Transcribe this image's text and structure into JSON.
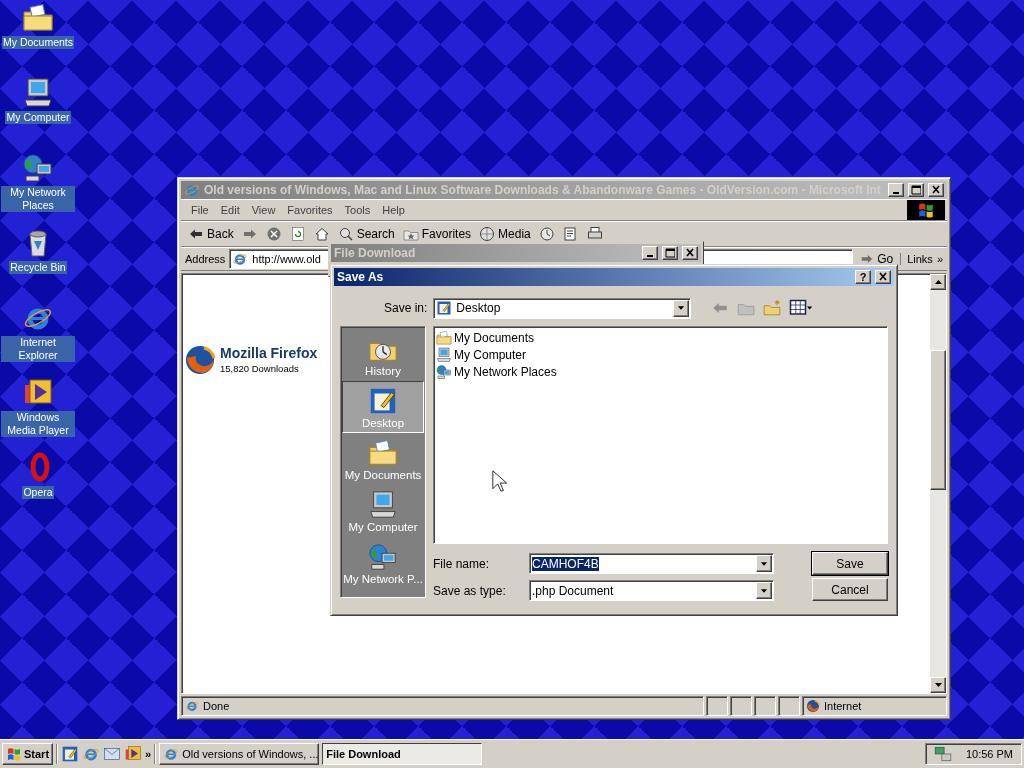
{
  "desktop_icons": [
    {
      "label": "My Documents",
      "kind": "documents"
    },
    {
      "label": "My Computer",
      "kind": "computer"
    },
    {
      "label": "My Network Places",
      "kind": "network"
    },
    {
      "label": "Recycle Bin",
      "kind": "recycle"
    },
    {
      "label": "Internet Explorer",
      "kind": "ie"
    },
    {
      "label": "Windows Media Player",
      "kind": "media"
    },
    {
      "label": "Opera",
      "kind": "opera"
    }
  ],
  "browser": {
    "title": "Old versions of Windows, Mac and Linux Software Downloads & Abandonware Games - OldVersion.com - Microsoft Int",
    "menu": [
      "File",
      "Edit",
      "View",
      "Favorites",
      "Tools",
      "Help"
    ],
    "toolbar": [
      {
        "kind": "back",
        "label": "Back"
      },
      {
        "kind": "forward"
      },
      {
        "kind": "stop"
      },
      {
        "kind": "refresh"
      },
      {
        "kind": "home"
      },
      {
        "kind": "search",
        "label": "Search"
      },
      {
        "kind": "favorites",
        "label": "Favorites"
      },
      {
        "kind": "media",
        "label": "Media"
      },
      {
        "kind": "history"
      },
      {
        "kind": "mail"
      },
      {
        "kind": "print"
      }
    ],
    "address_label": "Address",
    "address": "http://www.old",
    "go": "Go",
    "links": "Links",
    "links_chevron": "»",
    "page": {
      "title": "Mozilla Firefox",
      "downloads": "15,820 Downloads"
    },
    "status": "Done",
    "zone": "Internet"
  },
  "file_download": {
    "title": "File Download"
  },
  "save_as": {
    "title": "Save As",
    "help": "?",
    "save_in_label": "Save in:",
    "save_in": "Desktop",
    "places": [
      {
        "label": "History",
        "kind": "history",
        "selected": false
      },
      {
        "label": "Desktop",
        "kind": "desktop",
        "selected": true
      },
      {
        "label": "My Documents",
        "kind": "documents",
        "selected": false
      },
      {
        "label": "My Computer",
        "kind": "computer",
        "selected": false
      },
      {
        "label": "My Network P...",
        "kind": "network",
        "selected": false
      }
    ],
    "files": [
      {
        "name": "My Documents",
        "kind": "documents"
      },
      {
        "name": "My Computer",
        "kind": "computer"
      },
      {
        "name": "My Network Places",
        "kind": "network"
      }
    ],
    "file_name_label": "File name:",
    "file_name": "CAMHOF4B",
    "type_label": "Save as type:",
    "type": ".php Document",
    "buttons": [
      "Save",
      "Cancel"
    ]
  },
  "taskbar": {
    "start": "Start",
    "quick_launch": [
      {
        "kind": "desktop"
      },
      {
        "kind": "ie"
      },
      {
        "kind": "outlook"
      },
      {
        "kind": "media"
      }
    ],
    "chevron": "»",
    "tasks": [
      {
        "label": "Old versions of Windows, ...",
        "selected": false
      },
      {
        "label": "File Download",
        "selected": true
      }
    ],
    "clock": "10:56 PM"
  }
}
